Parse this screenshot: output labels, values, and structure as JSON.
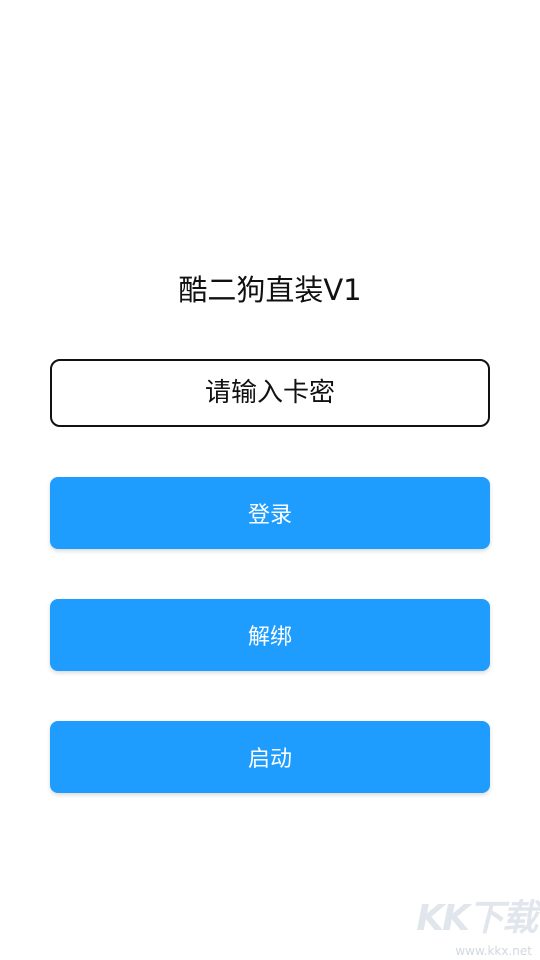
{
  "app": {
    "title": "酷二狗直装V1"
  },
  "card": {
    "placeholder": "请输入卡密"
  },
  "buttons": {
    "login_label": "登录",
    "unbind_label": "解绑",
    "start_label": "启动"
  },
  "watermark": {
    "logo_text": "KK下载",
    "url": "www.kkx.net"
  },
  "colors": {
    "button": "#1f9dff",
    "text": "#111111",
    "background": "#ffffff"
  }
}
